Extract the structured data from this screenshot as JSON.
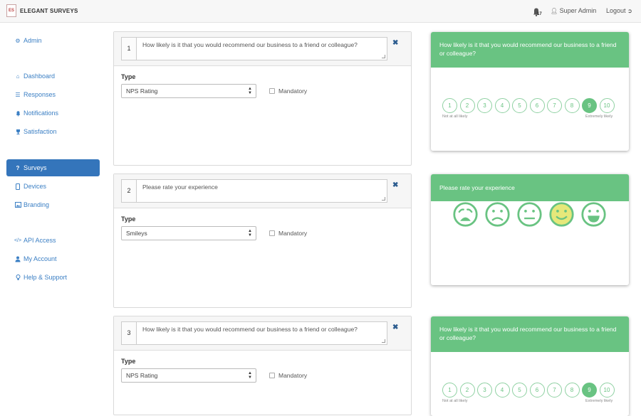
{
  "app": {
    "logo_text": "ES",
    "brand": "ELEGANT SURVEYS"
  },
  "topbar": {
    "notification_count": "17",
    "user": "Super Admin",
    "logout": "Logout"
  },
  "sidebar": {
    "items": [
      {
        "label": "Admin",
        "icon": "gear-icon",
        "active": false
      },
      {
        "label": "Dashboard",
        "icon": "home-icon",
        "active": false
      },
      {
        "label": "Responses",
        "icon": "list-icon",
        "active": false
      },
      {
        "label": "Notifications",
        "icon": "bell-icon",
        "active": false
      },
      {
        "label": "Satisfaction",
        "icon": "trophy-icon",
        "active": false
      },
      {
        "label": "Surveys",
        "icon": "question-icon",
        "active": true
      },
      {
        "label": "Devices",
        "icon": "tablet-icon",
        "active": false
      },
      {
        "label": "Branding",
        "icon": "image-icon",
        "active": false
      },
      {
        "label": "API Access",
        "icon": "code-icon",
        "active": false
      },
      {
        "label": "My Account",
        "icon": "user-icon",
        "active": false
      },
      {
        "label": "Help & Support",
        "icon": "lightbulb-icon",
        "active": false
      }
    ]
  },
  "questions": [
    {
      "number": "1",
      "text": "How likely is it that you would recommend our business to a friend or colleague?",
      "type_label": "Type",
      "type_value": "NPS Rating",
      "mandatory_label": "Mandatory"
    },
    {
      "number": "2",
      "text": "Please rate your experience",
      "type_label": "Type",
      "type_value": "Smileys",
      "mandatory_label": "Mandatory"
    },
    {
      "number": "3",
      "text": "How likely is it that you would recommend our business to a friend or colleague?",
      "type_label": "Type",
      "type_value": "NPS Rating",
      "mandatory_label": "Mandatory"
    }
  ],
  "previews": [
    {
      "title": "How likely is it that you would recommend our business to a friend or colleague?",
      "scale": [
        "1",
        "2",
        "3",
        "4",
        "5",
        "6",
        "7",
        "8",
        "9",
        "10"
      ],
      "selected": "9",
      "low_label": "Not at all likely",
      "high_label": "Extremely likely"
    },
    {
      "title": "Please rate your experience",
      "smileys": [
        "very-sad-face-icon",
        "sad-face-icon",
        "neutral-face-icon",
        "happy-face-icon",
        "very-happy-face-icon"
      ],
      "highlighted": "happy-face-icon"
    },
    {
      "title": "How likely is it that you would recommend our business to a friend or colleague?",
      "scale": [
        "1",
        "2",
        "3",
        "4",
        "5",
        "6",
        "7",
        "8",
        "9",
        "10"
      ],
      "selected": "9",
      "low_label": "Not at all likely",
      "high_label": "Extremely likely"
    }
  ],
  "colors": {
    "accent_green": "#69c382",
    "primary_blue": "#3475bb",
    "link_blue": "#3b7fc4",
    "smiley_highlight": "#e6e87a"
  }
}
